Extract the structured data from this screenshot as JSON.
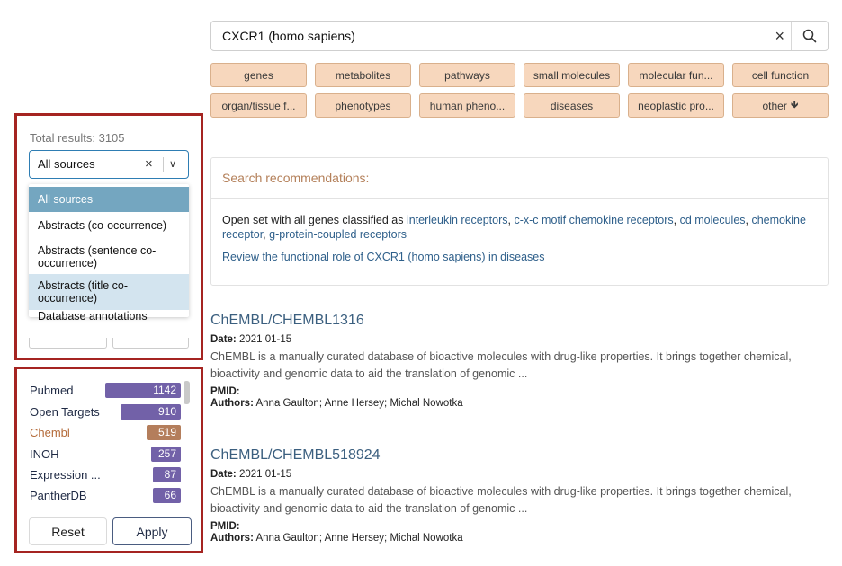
{
  "search": {
    "value": "CXCR1 (homo sapiens)",
    "clear_icon": "×"
  },
  "categories": [
    "genes",
    "metabolites",
    "pathways",
    "small molecules",
    "molecular fun...",
    "cell function",
    "organ/tissue f...",
    "phenotypes",
    "human pheno...",
    "diseases",
    "neoplastic pro...",
    "other"
  ],
  "other_arrow": "🡻",
  "sources_filter": {
    "total": "Total results: 3105",
    "selected": "All sources",
    "clear_icon": "×",
    "chevron": "∨",
    "options": [
      "All sources",
      "Abstracts (co-occurrence)",
      "Abstracts (sentence co-occurrence)",
      "Abstracts (title co-occurrence)",
      "Database annotations"
    ]
  },
  "source_counts": {
    "items": [
      {
        "name": "Pubmed",
        "count": "1142"
      },
      {
        "name": "Open Targets",
        "count": "910"
      },
      {
        "name": "Chembl",
        "count": "519"
      },
      {
        "name": "INOH",
        "count": "257"
      },
      {
        "name": "Expression ...",
        "count": "87"
      },
      {
        "name": "PantherDB",
        "count": "66"
      }
    ],
    "reset": "Reset",
    "apply": "Apply"
  },
  "recommendations": {
    "heading": "Search recommendations:",
    "line1_prefix": "Open set with all genes classified as ",
    "links": [
      "interleukin receptors",
      "c-x-c motif chemokine receptors",
      "cd molecules",
      "chemokine receptor",
      "g-protein-coupled receptors"
    ],
    "sep": ", ",
    "line2": "Review the functional role of CXCR1 (homo sapiens) in diseases"
  },
  "results": [
    {
      "title": "ChEMBL/CHEMBL1316",
      "date_label": "Date:",
      "date": "2021 01-15",
      "description": "ChEMBL is a manually curated database of bioactive molecules with drug-like properties. It brings together chemical, bioactivity and genomic data to aid the translation of genomic ...",
      "pmid_label": "PMID:",
      "authors_label": "Authors:",
      "authors": "Anna Gaulton; Anne Hersey; Michal Nowotka"
    },
    {
      "title": "ChEMBL/CHEMBL518924",
      "date_label": "Date:",
      "date": "2021 01-15",
      "description": "ChEMBL is a manually curated database of bioactive molecules with drug-like properties. It brings together chemical, bioactivity and genomic data to aid the translation of genomic ...",
      "pmid_label": "PMID:",
      "authors_label": "Authors:",
      "authors": "Anna Gaulton; Anne Hersey; Michal Nowotka"
    }
  ],
  "colors": {
    "chip_bg": "#f7d7bd",
    "bar": "#7261a8",
    "bar_highlight": "#b47e5c",
    "highlight_box": "#a52421",
    "selected_option": "#74a6c0"
  }
}
